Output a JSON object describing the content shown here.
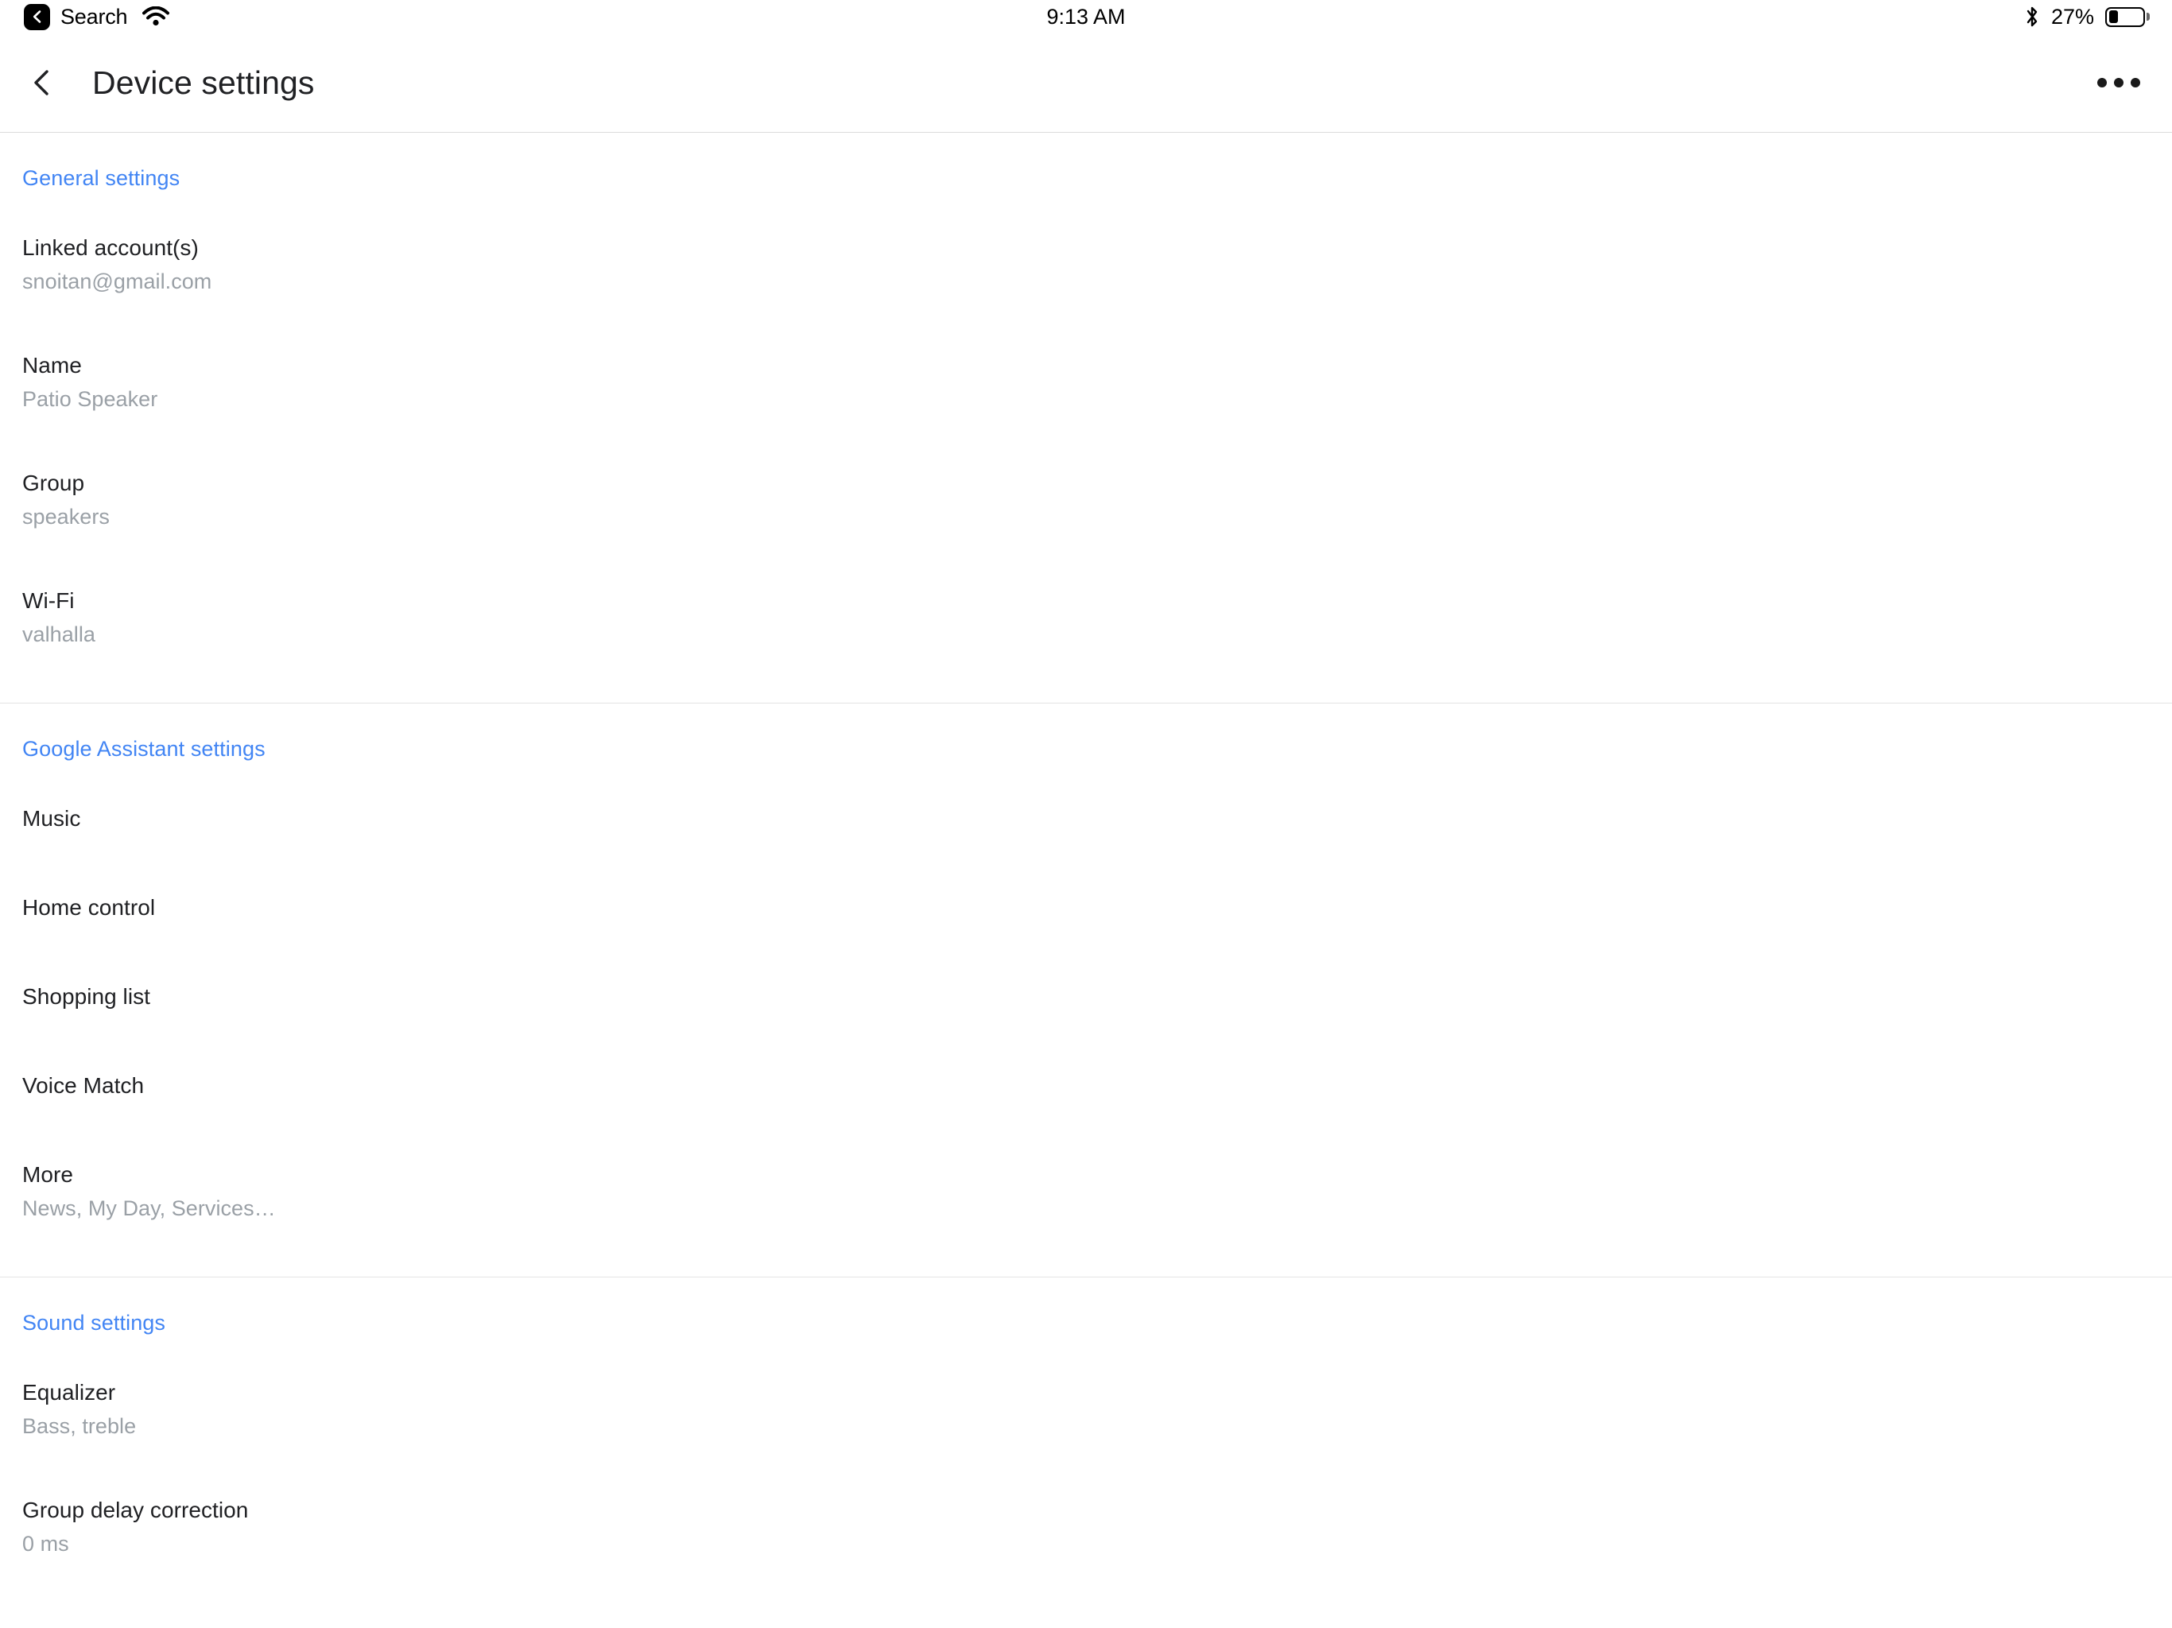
{
  "status_bar": {
    "back_label": "Search",
    "back_icon": "back-chevron-badge-icon",
    "wifi_icon": "wifi-icon",
    "time": "9:13 AM",
    "bluetooth_icon": "bluetooth-icon",
    "battery_percent": "27%",
    "battery_level": 27,
    "battery_icon": "battery-icon"
  },
  "header": {
    "back_icon": "back-chevron-icon",
    "title": "Device settings",
    "overflow_icon": "overflow-menu-icon"
  },
  "colors": {
    "accent_blue": "#4285f4",
    "title_text": "#202124",
    "subtitle_text": "#9aa0a6",
    "divider": "#e4e4e4"
  },
  "sections": [
    {
      "title": "General settings",
      "items": [
        {
          "title": "Linked account(s)",
          "subtitle": "snoitan@gmail.com"
        },
        {
          "title": "Name",
          "subtitle": "Patio Speaker"
        },
        {
          "title": "Group",
          "subtitle": "speakers"
        },
        {
          "title": "Wi-Fi",
          "subtitle": "valhalla"
        }
      ]
    },
    {
      "title": "Google Assistant settings",
      "items": [
        {
          "title": "Music",
          "subtitle": ""
        },
        {
          "title": "Home control",
          "subtitle": ""
        },
        {
          "title": "Shopping list",
          "subtitle": ""
        },
        {
          "title": "Voice Match",
          "subtitle": ""
        },
        {
          "title": "More",
          "subtitle": "News, My Day, Services…"
        }
      ]
    },
    {
      "title": "Sound settings",
      "items": [
        {
          "title": "Equalizer",
          "subtitle": "Bass, treble"
        },
        {
          "title": "Group delay correction",
          "subtitle": "0 ms"
        }
      ]
    }
  ]
}
